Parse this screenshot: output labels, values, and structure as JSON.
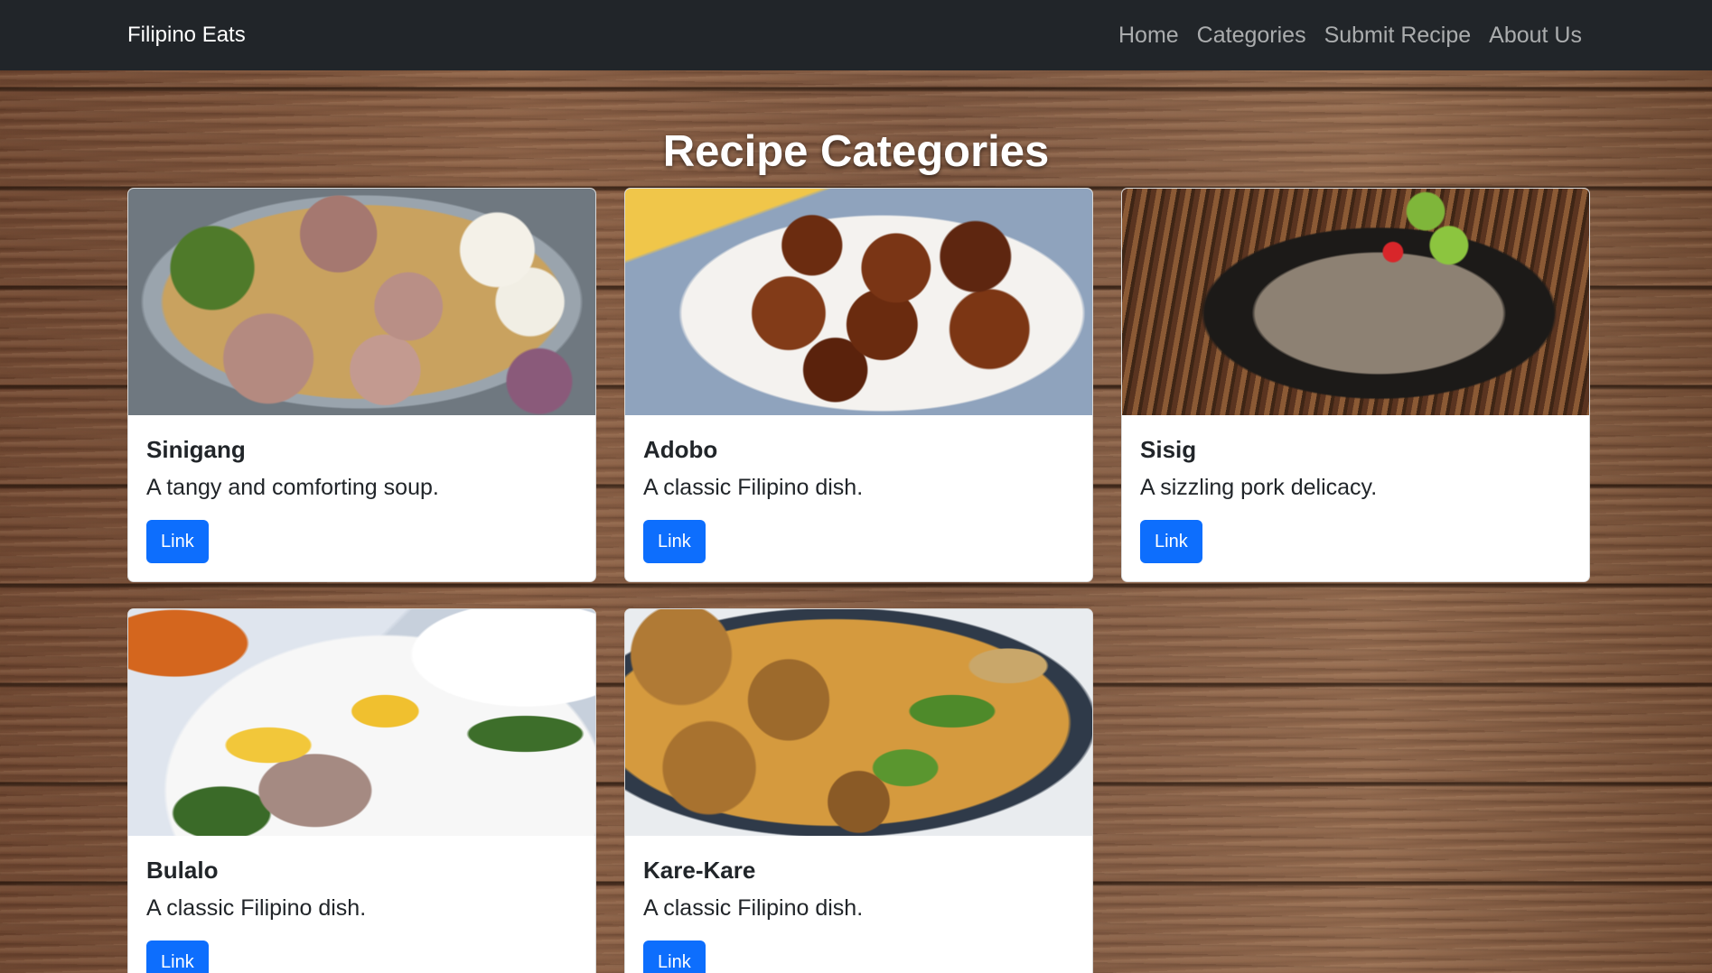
{
  "navbar": {
    "brand": "Filipino Eats",
    "links": [
      "Home",
      "Categories",
      "Submit Recipe",
      "About Us"
    ]
  },
  "page": {
    "title": "Recipe Categories"
  },
  "cards": [
    {
      "title": "Sinigang",
      "text": "A tangy and comforting soup.",
      "button": "Link",
      "image": "sinigang-photo"
    },
    {
      "title": "Adobo",
      "text": "A classic Filipino dish.",
      "button": "Link",
      "image": "adobo-photo"
    },
    {
      "title": "Sisig",
      "text": "A sizzling pork delicacy.",
      "button": "Link",
      "image": "sisig-photo"
    },
    {
      "title": "Bulalo",
      "text": "A classic Filipino dish.",
      "button": "Link",
      "image": "bulalo-photo"
    },
    {
      "title": "Kare-Kare",
      "text": "A classic Filipino dish.",
      "button": "Link",
      "image": "kare-kare-photo"
    }
  ],
  "colors": {
    "navbar": "#212529",
    "button": "#0d6efd",
    "card": "#ffffff"
  }
}
